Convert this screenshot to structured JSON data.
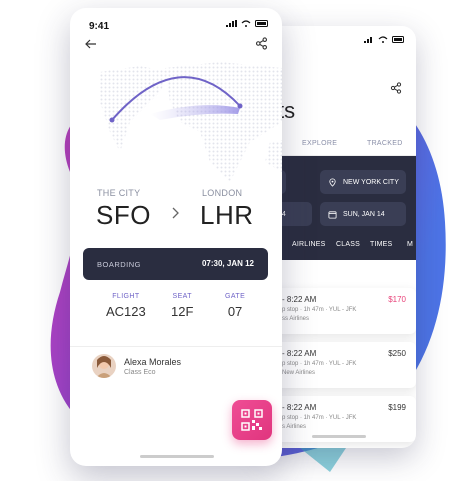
{
  "colors": {
    "accent": "#6f63c7",
    "dark_panel": "#2a2d40",
    "pink": "#ec4a92",
    "blob_blue": "#4f6fe0",
    "blob_purple": "#9a3fd6"
  },
  "front": {
    "status_time": "9:41",
    "origin": {
      "city": "THE CITY",
      "code": "SFO"
    },
    "destination": {
      "city": "LONDON",
      "code": "LHR"
    },
    "boarding": {
      "label": "BOARDING",
      "time": "07:30, JAN 12"
    },
    "info": [
      {
        "label": "FLIGHT",
        "value": "AC123"
      },
      {
        "label": "SEAT",
        "value": "12F"
      },
      {
        "label": "GATE",
        "value": "07"
      }
    ],
    "passenger": {
      "name": "Alexa Morales",
      "class": "Class Eco"
    },
    "icons": {
      "back": "arrow-left-icon",
      "share": "share-icon",
      "qr": "qr-code-icon"
    }
  },
  "back": {
    "title_fragment": "ts",
    "tabs": [
      "EXPLORE",
      "TRACKED"
    ],
    "fields": {
      "to_city": "NEW YORK CITY",
      "date_left": "14",
      "date_right": "SUN, JAN 14"
    },
    "filters": [
      "AIRLINES",
      "CLASS",
      "TIMES",
      "M"
    ],
    "section_label": "T",
    "flights": [
      {
        "time": "- 8:22 AM",
        "meta": "p stop · 1h 47m · YUL - JFK",
        "airline": "ss Airlines",
        "price": "$170"
      },
      {
        "time": "- 8:22 AM",
        "meta": "p stop · 1h 47m · YUL - JFK",
        "airline": "New Airlines",
        "price": "$250"
      },
      {
        "time": "- 8:22 AM",
        "meta": "p stop · 1h 47m · YUL - JFK",
        "airline": "s Airlines",
        "price": "$199"
      }
    ]
  }
}
